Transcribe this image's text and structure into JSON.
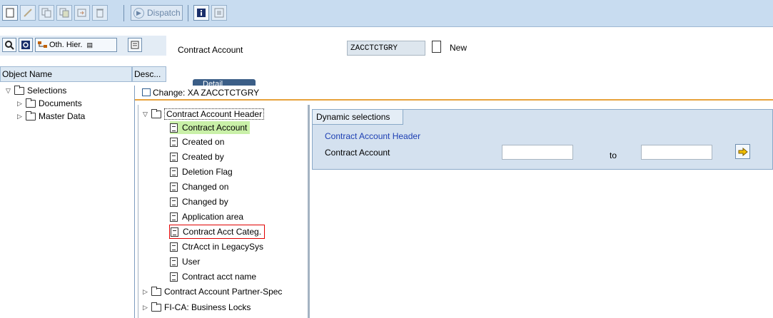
{
  "toolbar": {
    "dispatch_label": "Dispatch",
    "icons": [
      "new-document-icon",
      "edit-icon",
      "copy-icon",
      "copy-as-icon",
      "transport-icon",
      "delete-icon",
      "info-icon",
      "display-object-icon"
    ]
  },
  "left_panel": {
    "other_hierarchy_label": "Oth. Hier.",
    "columns": [
      "Object Name",
      "Desc..."
    ],
    "tree": [
      {
        "label": "Selections",
        "expanded": true
      },
      {
        "label": "Documents",
        "expanded": false
      },
      {
        "label": "Master Data",
        "expanded": false
      }
    ]
  },
  "header_field": {
    "label": "Contract Account",
    "value": "ZACCTCTGRY",
    "status": "New"
  },
  "detail_tab": {
    "label": "Detail"
  },
  "popup": {
    "title": "Change: XA ZACCTCTGRY",
    "tree": {
      "root": "Contract Account Header",
      "children": [
        "Contract Account",
        "Created on",
        "Created by",
        "Deletion Flag",
        "Changed on",
        "Changed by",
        "Application area",
        "Contract Acct Categ.",
        "CtrAcct in LegacySys",
        "User",
        "Contract acct name"
      ],
      "collapsed": [
        "Contract Account Partner-Spec",
        "FI-CA: Business Locks"
      ]
    },
    "dynamic_selections": {
      "tab_label": "Dynamic selections",
      "group_label": "Contract Account Header",
      "field_label": "Contract Account",
      "from_value": "",
      "to_label": "to",
      "to_value": ""
    }
  },
  "colors": {
    "toolbar_bg": "#c8dcf0",
    "highlight": "#c9f0a8",
    "selection_border": "#e00000",
    "link_blue": "#1d3fb3",
    "title_underline": "#e8a23c"
  }
}
